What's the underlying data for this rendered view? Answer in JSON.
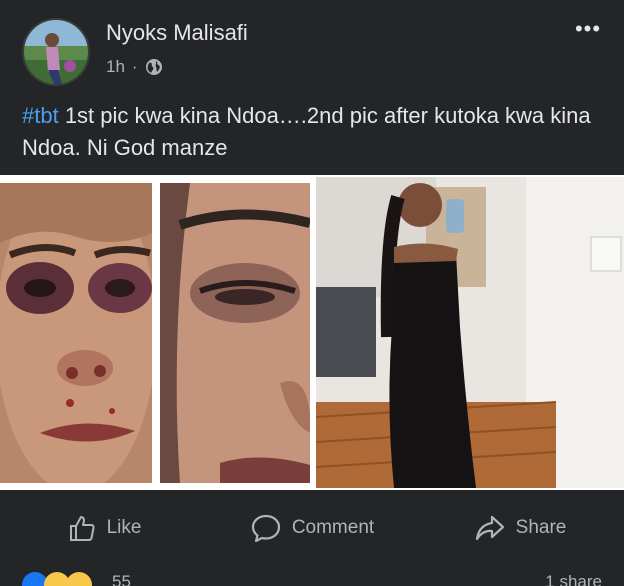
{
  "post": {
    "author": "Nyoks Malisafi",
    "time": "1h",
    "separator": "·",
    "more_icon": "•••",
    "caption_hashtag": "#tbt",
    "caption_text": " 1st pic kwa kina Ndoa….2nd pic after kutoka kwa kina Ndoa. Ni God manze"
  },
  "actions": {
    "like_label": "Like",
    "comment_label": "Comment",
    "share_label": "Share"
  },
  "footer": {
    "reaction_count": "55",
    "shares_text": "1 share"
  },
  "colors": {
    "background": "#242526",
    "hashtag": "#4b9ef0",
    "text_primary": "#e4e6eb",
    "text_secondary": "#b0b3b8"
  }
}
